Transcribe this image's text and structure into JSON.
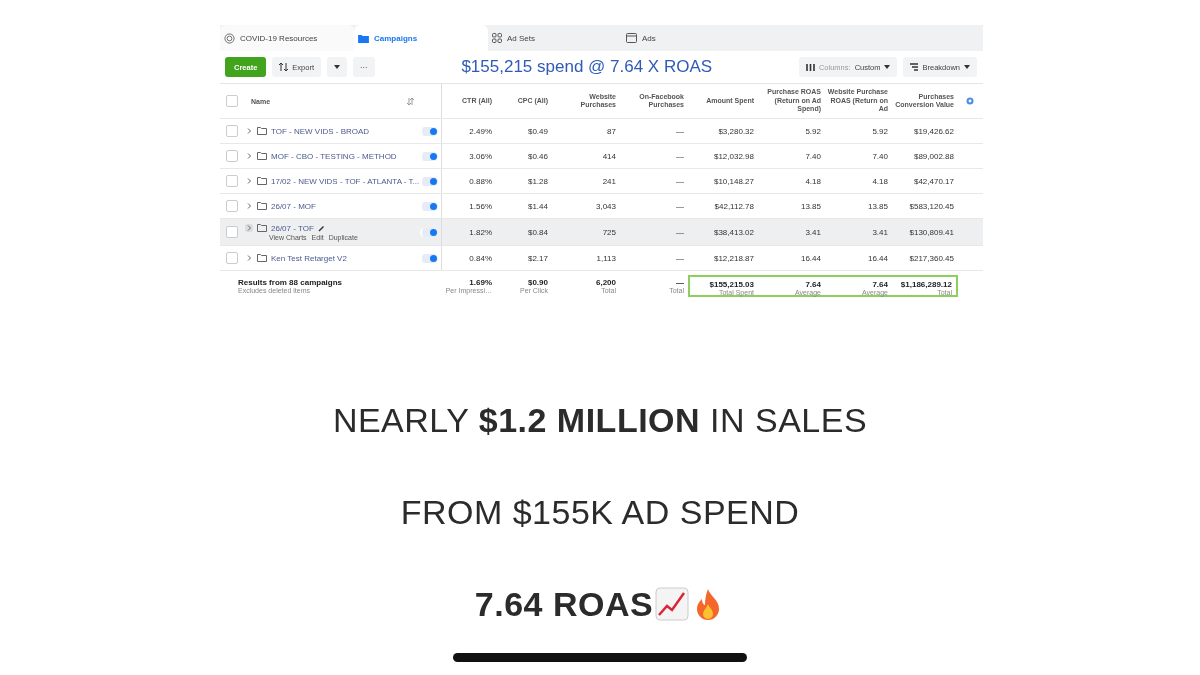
{
  "ads_screenshot": {
    "tabs": [
      {
        "label": "COVID-19 Resources",
        "kind": "resources",
        "selected": false
      },
      {
        "label": "Campaigns",
        "kind": "campaigns",
        "selected": true
      },
      {
        "label": "Ad Sets",
        "kind": "adsets",
        "selected": false
      },
      {
        "label": "Ads",
        "kind": "ads",
        "selected": false
      }
    ],
    "toolbar": {
      "create": "Create",
      "export": "Export",
      "more": "···",
      "headline": "$155,215 spend @ 7.64 X ROAS",
      "columns_label": "Columns:",
      "columns_value": "Custom",
      "breakdown": "Breakdown"
    },
    "table": {
      "all_checked": false,
      "name_column": "Name",
      "columns": [
        "CTR (All)",
        "CPC (All)",
        "Website Purchases",
        "On-Facebook Purchases",
        "Amount Spent",
        "Purchase ROAS (Return on Ad Spend)",
        "Website Purchase ROAS (Return on Ad",
        "Purchases Conversion Value"
      ],
      "rows": [
        {
          "name": "TOF - NEW VIDS - BROAD",
          "on": true,
          "checked": false,
          "highlighted": false,
          "cells": [
            "2.49%",
            "$0.49",
            "87",
            "—",
            "$3,280.32",
            "5.92",
            "5.92",
            "$19,426.62"
          ]
        },
        {
          "name": "MOF - CBO - TESTING - METHOD",
          "on": true,
          "checked": false,
          "highlighted": false,
          "cells": [
            "3.06%",
            "$0.46",
            "414",
            "—",
            "$12,032.98",
            "7.40",
            "7.40",
            "$89,002.88"
          ]
        },
        {
          "name": "17/02 - NEW VIDS - TOF - ATLANTA - T...",
          "on": true,
          "checked": false,
          "highlighted": false,
          "cells": [
            "0.88%",
            "$1.28",
            "241",
            "—",
            "$10,148.27",
            "4.18",
            "4.18",
            "$42,470.17"
          ]
        },
        {
          "name": "26/07 - MOF",
          "on": true,
          "checked": false,
          "highlighted": false,
          "cells": [
            "1.56%",
            "$1.44",
            "3,043",
            "—",
            "$42,112.78",
            "13.85",
            "13.85",
            "$583,120.45"
          ]
        },
        {
          "name": "26/07 - TOF",
          "on": true,
          "checked": false,
          "highlighted": true,
          "actions": [
            "View Charts",
            "Edit",
            "Duplicate"
          ],
          "cells": [
            "1.82%",
            "$0.84",
            "725",
            "—",
            "$38,413.02",
            "3.41",
            "3.41",
            "$130,809.41"
          ]
        },
        {
          "name": "Ken Test Retarget V2",
          "on": true,
          "checked": false,
          "highlighted": false,
          "cells": [
            "0.84%",
            "$2.17",
            "1,113",
            "—",
            "$12,218.87",
            "16.44",
            "16.44",
            "$217,360.45"
          ]
        }
      ],
      "totals": {
        "label": "Results from 88 campaigns",
        "note": "Excludes deleted items",
        "cells": [
          {
            "value": "1.69%",
            "sub": "Per Impressi…",
            "highlighted": false
          },
          {
            "value": "$0.90",
            "sub": "Per Click",
            "highlighted": false
          },
          {
            "value": "6,200",
            "sub": "Total",
            "highlighted": false
          },
          {
            "value": "—",
            "sub": "Total",
            "highlighted": false
          },
          {
            "value": "$155,215.03",
            "sub": "Total Spent",
            "highlighted": true
          },
          {
            "value": "7.64",
            "sub": "Average",
            "highlighted": true
          },
          {
            "value": "7.64",
            "sub": "Average",
            "highlighted": true
          },
          {
            "value": "$1,186,289.12",
            "sub": "Total",
            "highlighted": true
          }
        ]
      }
    }
  },
  "caption_lines": [
    {
      "text": "NEARLY **$1.2 MILLION** IN SALES",
      "kind": "plain"
    },
    {
      "text": "FROM $155K AD SPEND",
      "kind": "plain"
    },
    {
      "text": "7.64 ROAS",
      "kind": "emphasis"
    }
  ]
}
